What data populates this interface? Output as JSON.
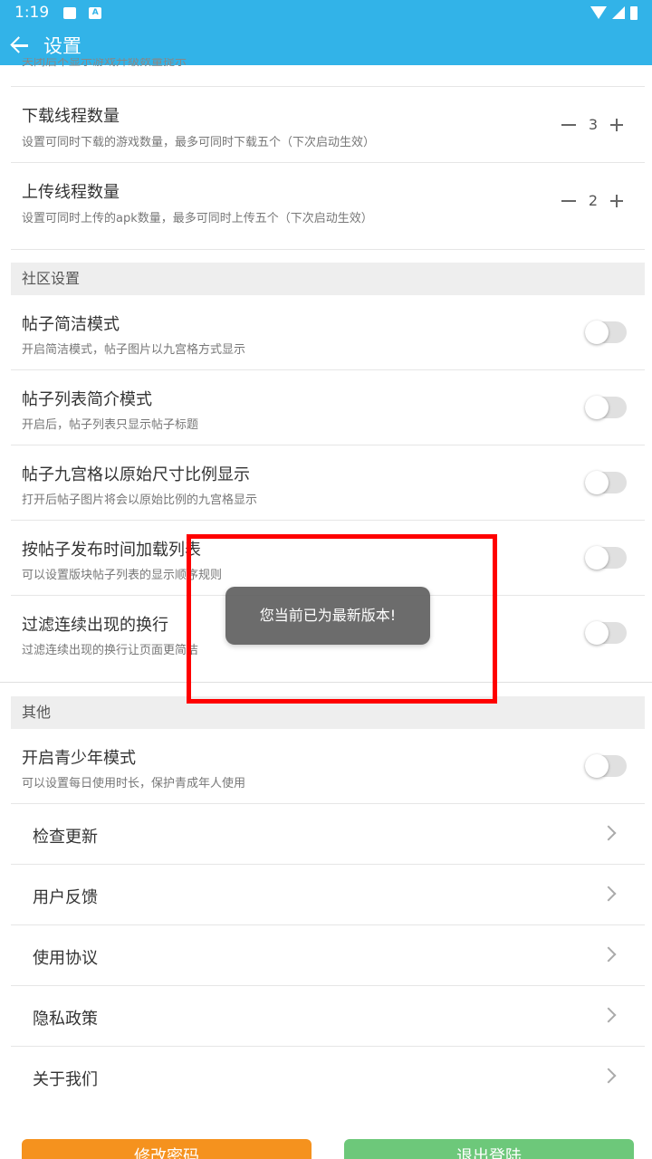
{
  "status_bar": {
    "time": "1:19"
  },
  "toolbar": {
    "title": "设置"
  },
  "clipped_text": "关闭后不显示游戏升级数量提示",
  "download": {
    "title": "下载线程数量",
    "subtitle": "设置可同时下载的游戏数量，最多可同时下载五个（下次启动生效）",
    "value": "3"
  },
  "upload": {
    "title": "上传线程数量",
    "subtitle": "设置可同时上传的apk数量，最多可同时上传五个（下次启动生效）",
    "value": "2"
  },
  "community": {
    "header": "社区设置",
    "items": [
      {
        "title": "帖子简洁模式",
        "subtitle": "开启简洁模式，帖子图片以九宫格方式显示"
      },
      {
        "title": "帖子列表简介模式",
        "subtitle": "开启后，帖子列表只显示帖子标题"
      },
      {
        "title": "帖子九宫格以原始尺寸比例显示",
        "subtitle": "打开后帖子图片将会以原始比例的九宫格显示"
      },
      {
        "title": "按帖子发布时间加载列表",
        "subtitle": "可以设置版块帖子列表的显示顺序规则"
      },
      {
        "title": "过滤连续出现的换行",
        "subtitle": "过滤连续出现的换行让页面更简洁"
      }
    ]
  },
  "other": {
    "header": "其他",
    "teen": {
      "title": "开启青少年模式",
      "subtitle": "可以设置每日使用时长，保护青成年人使用"
    },
    "links": [
      "检查更新",
      "用户反馈",
      "使用协议",
      "隐私政策",
      "关于我们"
    ]
  },
  "buttons": {
    "change_password": "修改密码",
    "logout": "退出登陆"
  },
  "toast": "您当前已为最新版本!"
}
